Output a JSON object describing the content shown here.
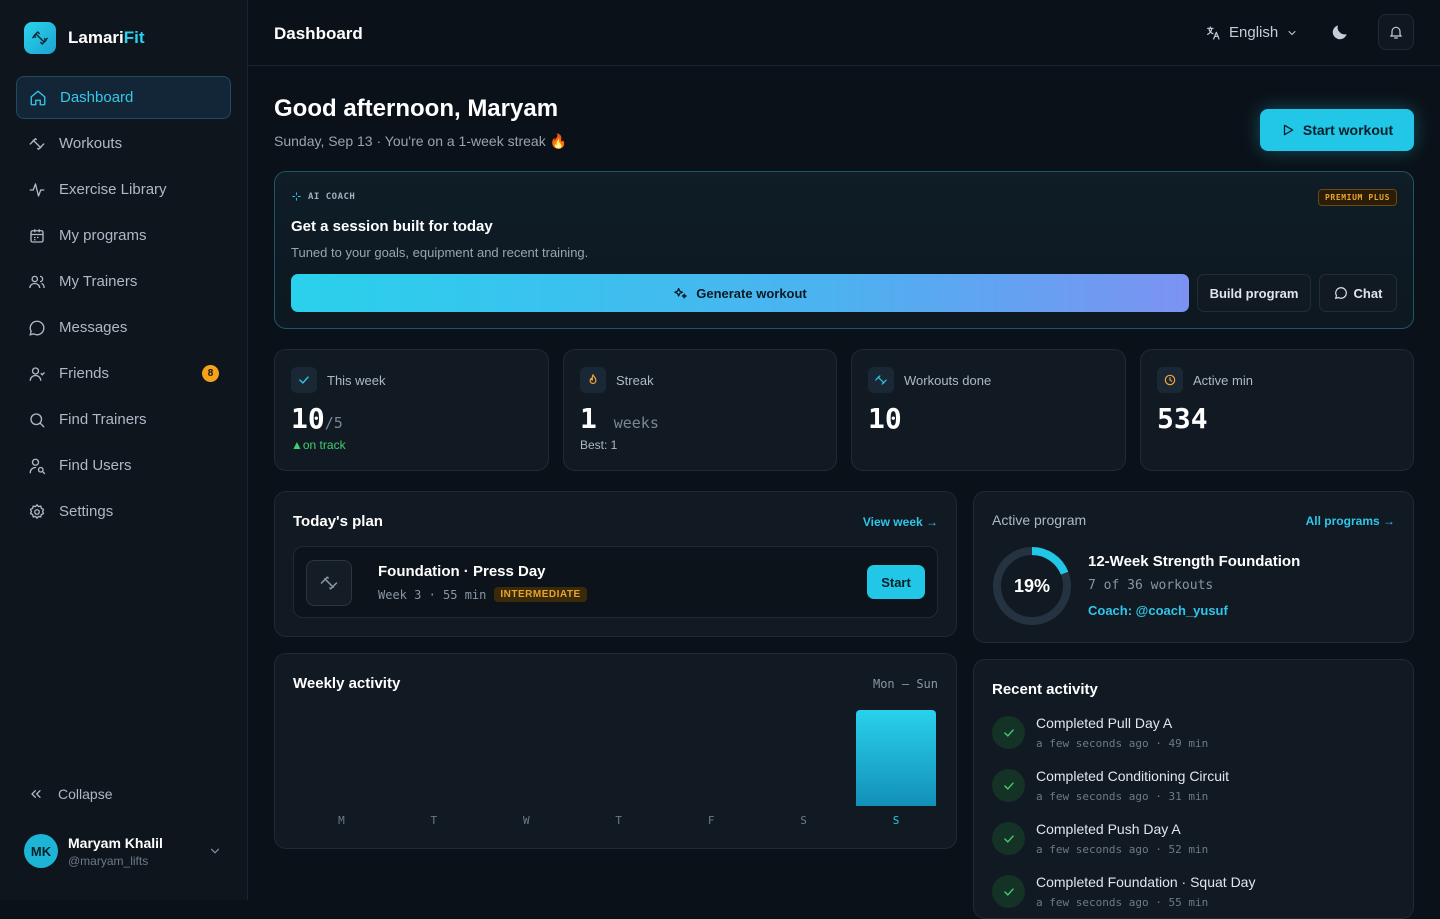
{
  "brand": {
    "name_a": "Lamari",
    "name_b": "Fit"
  },
  "nav": [
    {
      "label": "Dashboard",
      "icon": "home-icon",
      "active": true
    },
    {
      "label": "Workouts",
      "icon": "dumbbell-icon"
    },
    {
      "label": "Exercise Library",
      "icon": "activity-icon"
    },
    {
      "label": "My programs",
      "icon": "calendar-icon"
    },
    {
      "label": "My Trainers",
      "icon": "users-icon"
    },
    {
      "label": "Messages",
      "icon": "message-icon"
    },
    {
      "label": "Friends",
      "icon": "friends-icon",
      "badge": "8"
    },
    {
      "label": "Find Trainers",
      "icon": "search-icon"
    },
    {
      "label": "Find Users",
      "icon": "user-search-icon"
    },
    {
      "label": "Settings",
      "icon": "gear-icon"
    }
  ],
  "sidebar": {
    "collapse_label": "Collapse"
  },
  "user": {
    "initials": "MK",
    "name": "Maryam Khalil",
    "handle": "@maryam_lifts"
  },
  "topbar": {
    "title": "Dashboard",
    "language": "English"
  },
  "hero": {
    "greeting": "Good afternoon, Maryam",
    "subtitle": "Sunday, Sep 13 · You're on a 1-week streak 🔥",
    "start_button": "Start workout"
  },
  "coach": {
    "tag": "AI COACH",
    "premium": "PREMIUM PLUS",
    "title": "Get a session built for today",
    "description": "Tuned to your goals, equipment and recent training.",
    "generate": "Generate workout",
    "build": "Build program",
    "chat": "Chat"
  },
  "stats": {
    "week": {
      "label": "This week",
      "value": "10",
      "target": "/5",
      "foot": "▲on track"
    },
    "streak": {
      "label": "Streak",
      "value": "1",
      "unit": "weeks",
      "foot": "Best: 1"
    },
    "workouts": {
      "label": "Workouts done",
      "value": "10"
    },
    "active": {
      "label": "Active min",
      "value": "534"
    }
  },
  "plan": {
    "title": "Today's plan",
    "link": "View week →",
    "name": "Foundation · Press Day",
    "meta": "Week 3 · 55 min",
    "level": "INTERMEDIATE",
    "start": "Start"
  },
  "program": {
    "label": "Active program",
    "link": "All programs →",
    "percent": "19%",
    "progress": 0.19,
    "name": "12-Week Strength Foundation",
    "count": "7 of 36 workouts",
    "coach": "Coach: @coach_yusuf"
  },
  "weekly": {
    "title": "Weekly activity",
    "range": "Mon — Sun",
    "days": [
      "M",
      "T",
      "W",
      "T",
      "F",
      "S",
      "S"
    ],
    "values": [
      0,
      0,
      0,
      0,
      0,
      0,
      1
    ],
    "today_index": 6
  },
  "recent": {
    "title": "Recent activity",
    "items": [
      {
        "title": "Completed Pull Day A",
        "meta": "a few seconds ago · 49 min"
      },
      {
        "title": "Completed Conditioning Circuit",
        "meta": "a few seconds ago · 31 min"
      },
      {
        "title": "Completed Push Day A",
        "meta": "a few seconds ago · 52 min"
      },
      {
        "title": "Completed Foundation · Squat Day",
        "meta": "a few seconds ago · 55 min"
      }
    ]
  },
  "colors": {
    "accent": "#22c6e6",
    "warning": "#e9a42b",
    "success": "#3fcf6e",
    "bg": "#0b1118"
  }
}
